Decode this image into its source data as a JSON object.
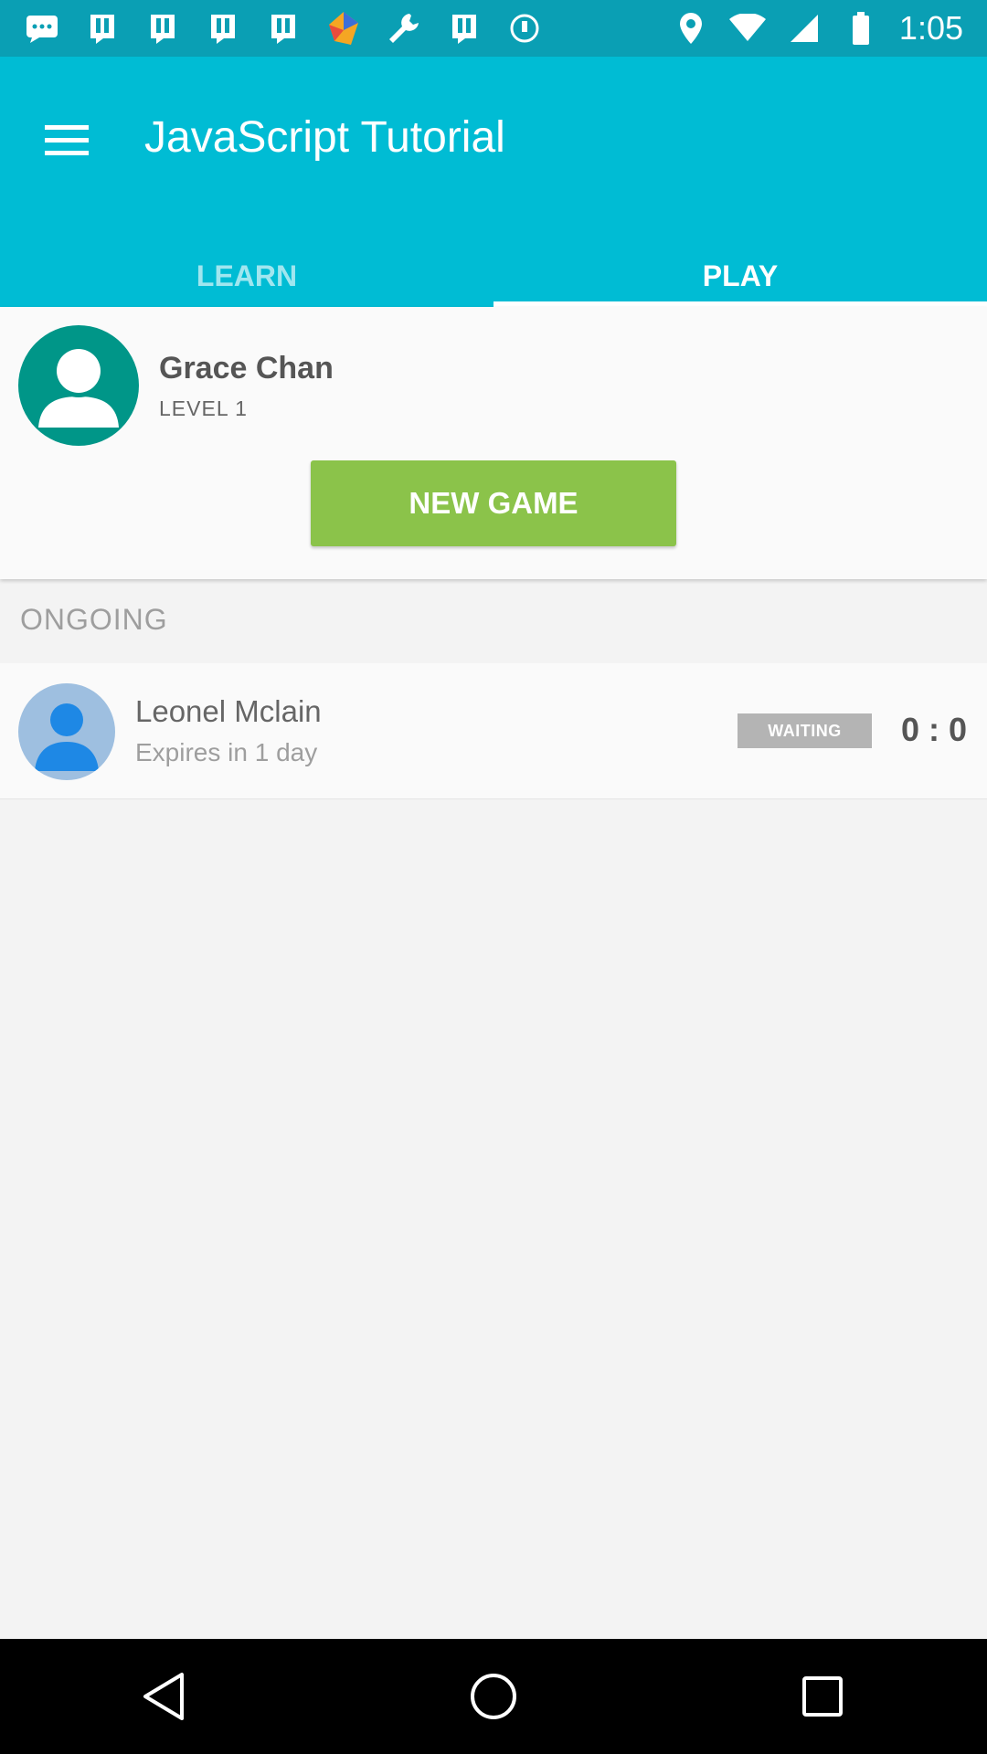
{
  "status_bar": {
    "time": "1:05",
    "icons": [
      "messages-icon",
      "notification-app-icon",
      "notification-app-icon",
      "notification-app-icon",
      "notification-app-icon",
      "colorful-app-icon",
      "wrench-icon",
      "notification-app-icon",
      "circle-status-icon",
      "location-icon",
      "wifi-icon",
      "signal-icon",
      "battery-icon"
    ]
  },
  "app_bar": {
    "title": "JavaScript Tutorial",
    "color": "#00bcd4"
  },
  "tabs": [
    {
      "label": "LEARN",
      "selected": false
    },
    {
      "label": "PLAY",
      "selected": true
    }
  ],
  "profile": {
    "name": "Grace Chan",
    "level": "LEVEL 1",
    "new_game_label": "NEW GAME",
    "button_color": "#8bc34a"
  },
  "ongoing": {
    "header": "ONGOING",
    "games": [
      {
        "opponent": "Leonel Mclain",
        "expires": "Expires in 1 day",
        "status": "WAITING",
        "score": "0 : 0"
      }
    ]
  },
  "nav_bar": {
    "buttons": [
      "back-icon",
      "home-icon",
      "recents-icon"
    ]
  }
}
